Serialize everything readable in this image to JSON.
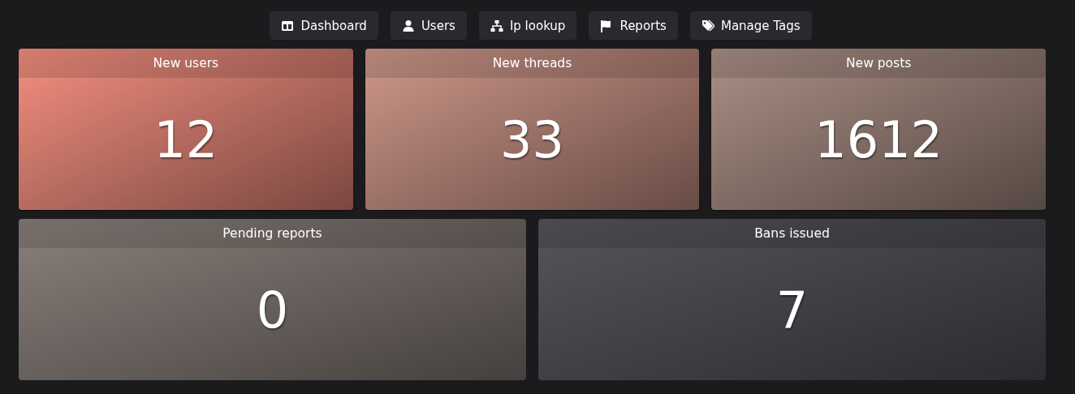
{
  "nav": [
    {
      "label": "Dashboard",
      "kind": "columns"
    },
    {
      "label": "Users",
      "kind": "person"
    },
    {
      "label": "Ip lookup",
      "kind": "network"
    },
    {
      "label": "Reports",
      "kind": "flag"
    },
    {
      "label": "Manage Tags",
      "kind": "tags"
    }
  ],
  "stats": [
    {
      "title": "New users",
      "value": "12",
      "color": "#f48f80"
    },
    {
      "title": "New threads",
      "value": "33",
      "color": "#cf978a"
    },
    {
      "title": "New posts",
      "value": "1612",
      "color": "#ab9086"
    },
    {
      "title": "Pending reports",
      "value": "0",
      "color": "#8a807b"
    },
    {
      "title": "Bans issued",
      "value": "7",
      "color": "#57555c"
    }
  ]
}
